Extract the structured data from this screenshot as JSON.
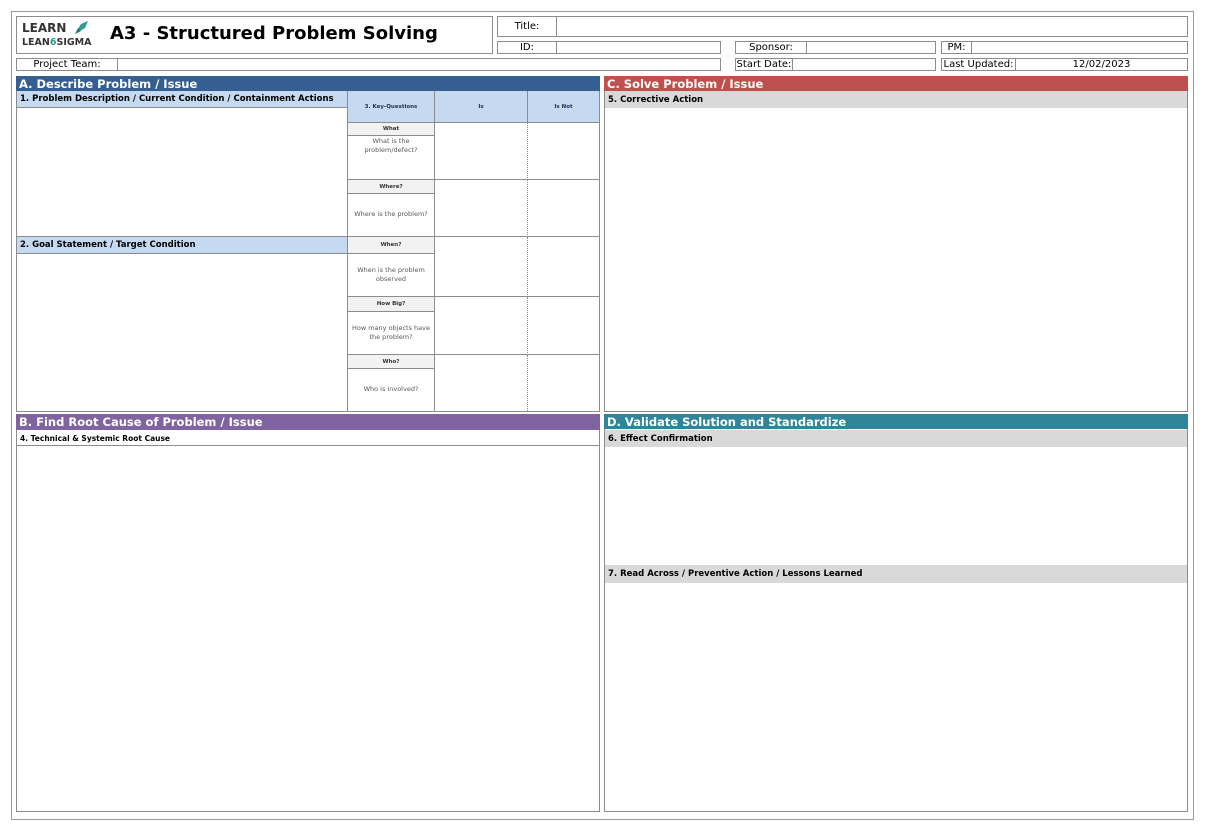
{
  "logo": {
    "line1": "LEARN",
    "line2a": "LEAN",
    "line2b": "6",
    "line2c": "SIGMA",
    "icon": "rocket-icon",
    "accent": "#2a9d8f"
  },
  "header": {
    "title_main": "A3 - Structured Problem Solving",
    "title_label": "Title:",
    "title_value": "",
    "id_label": "ID:",
    "id_value": "",
    "sponsor_label": "Sponsor:",
    "sponsor_value": "",
    "pm_label": "PM:",
    "pm_value": "",
    "team_label": "Project Team:",
    "team_value": "",
    "start_label": "Start Date:",
    "start_value": "",
    "updated_label": "Last Updated:",
    "updated_value": "12/02/2023"
  },
  "sections": {
    "a": "A. Describe Problem / Issue",
    "b": "B. Find Root Cause of Problem / Issue",
    "c": "C. Solve Problem / Issue",
    "d": "D. Validate Solution and Standardize"
  },
  "subsections": {
    "s1": "1. Problem Description / Current Condition / Containment Actions",
    "s2": "2. Goal Statement / Target Condition",
    "s4": "4. Technical & Systemic Root Cause",
    "s5": "5. Corrective Action",
    "s6": "6. Effect Confirmation",
    "s7": "7. Read Across / Preventive Action / Lessons Learned"
  },
  "questions_table": {
    "col_key": "3. Key-Questions",
    "col_is": "Is",
    "col_isnot": "Is Not",
    "rows": [
      {
        "head": "What",
        "question": "What is the problem/defect?"
      },
      {
        "head": "Where?",
        "question": "Where is the problem?"
      },
      {
        "head": "When?",
        "question": "When is the problem observed"
      },
      {
        "head": "How Big?",
        "question": "How many objects have the problem?"
      },
      {
        "head": "Who?",
        "question": "Who is involved?"
      }
    ]
  },
  "colors": {
    "section_a": "#355f91",
    "section_b": "#8064a2",
    "section_c": "#c0504d",
    "section_d": "#31859b",
    "subhead_blue": "#c5d9f1",
    "subhead_gray": "#d9d9d9"
  }
}
